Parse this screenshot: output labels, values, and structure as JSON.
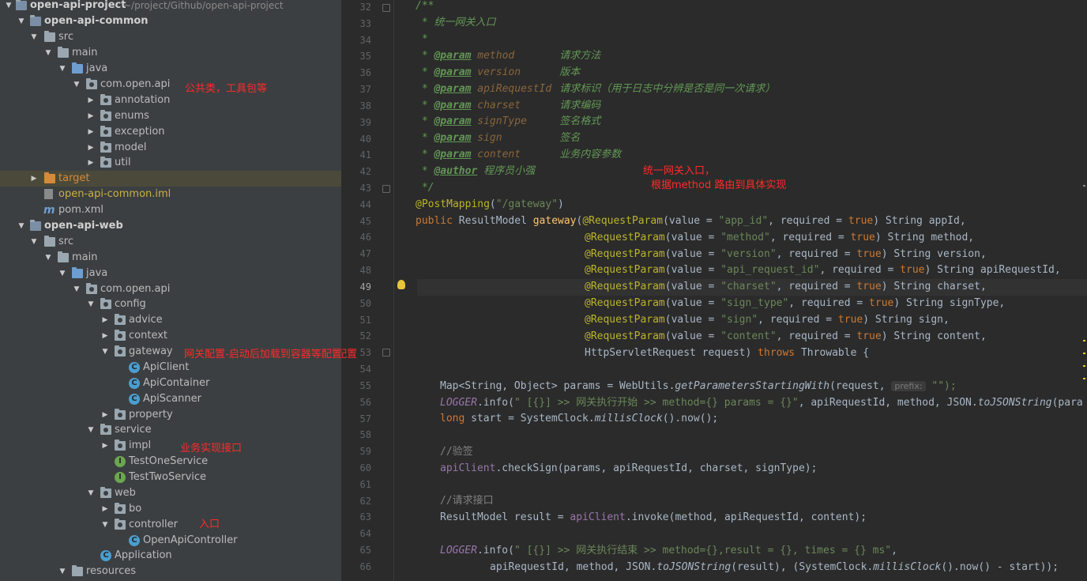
{
  "project_tree": {
    "root": {
      "name": "open-api-project",
      "path": "~/project/Github/open-api-project"
    },
    "items": [
      {
        "label": "open-api-common"
      },
      {
        "label": "src"
      },
      {
        "label": "main"
      },
      {
        "label": "java"
      },
      {
        "label": "com.open.api"
      },
      {
        "label": "annotation"
      },
      {
        "label": "enums"
      },
      {
        "label": "exception"
      },
      {
        "label": "model"
      },
      {
        "label": "util"
      },
      {
        "label": "target"
      },
      {
        "label": "open-api-common.iml"
      },
      {
        "label": "pom.xml"
      },
      {
        "label": "open-api-web"
      },
      {
        "label": "src"
      },
      {
        "label": "main"
      },
      {
        "label": "java"
      },
      {
        "label": "com.open.api"
      },
      {
        "label": "config"
      },
      {
        "label": "advice"
      },
      {
        "label": "context"
      },
      {
        "label": "gateway"
      },
      {
        "label": "ApiClient"
      },
      {
        "label": "ApiContainer"
      },
      {
        "label": "ApiScanner"
      },
      {
        "label": "property"
      },
      {
        "label": "service"
      },
      {
        "label": "impl"
      },
      {
        "label": "TestOneService"
      },
      {
        "label": "TestTwoService"
      },
      {
        "label": "web"
      },
      {
        "label": "bo"
      },
      {
        "label": "controller"
      },
      {
        "label": "OpenApiController"
      },
      {
        "label": "Application"
      },
      {
        "label": "resources"
      }
    ],
    "annotations": {
      "common_pkg": "公共类，工具包等",
      "gateway": "网关配置-启动后加载到容器等配置",
      "service": "业务实现接口",
      "controller": "入口"
    }
  },
  "editor": {
    "annotation_line1": "统一网关入口，",
    "annotation_line2": "根据method 路由到具体实现",
    "current_line": 49,
    "line_numbers": [
      "32",
      "33",
      "34",
      "35",
      "36",
      "37",
      "38",
      "39",
      "40",
      "41",
      "42",
      "43",
      "44",
      "45",
      "46",
      "47",
      "48",
      "49",
      "50",
      "51",
      "52",
      "53",
      "54",
      "55",
      "56",
      "57",
      "58",
      "59",
      "60",
      "61",
      "62",
      "63",
      "64",
      "65",
      "66"
    ],
    "doc": {
      "open": "/**",
      "summary": " * 统一网关入口",
      "star": " *",
      "params": [
        {
          "name": "method",
          "desc": "请求方法"
        },
        {
          "name": "version",
          "desc": "版本"
        },
        {
          "name": "apiRequestId",
          "desc": "请求标识（用于日志中分辨是否是同一次请求）"
        },
        {
          "name": "charset",
          "desc": "请求编码"
        },
        {
          "name": "signType",
          "desc": "签名格式"
        },
        {
          "name": "sign",
          "desc": "签名"
        },
        {
          "name": "content",
          "desc": "业务内容参数"
        }
      ],
      "author_tag": "@author",
      "author": "程序员小强",
      "close": " */"
    },
    "mapping": {
      "annotation": "@PostMapping",
      "path": "\"/gateway\""
    },
    "signature": {
      "modifier": "public",
      "return_type": "ResultModel",
      "method": "gateway"
    },
    "request_params": [
      {
        "value": "\"app_id\"",
        "required": "true",
        "type": "String",
        "name": "appId,"
      },
      {
        "value": "\"method\"",
        "required": "true",
        "type": "String",
        "name": "method,"
      },
      {
        "value": "\"version\"",
        "required": "true",
        "type": "String",
        "name": "version,"
      },
      {
        "value": "\"api_request_id\"",
        "required": "true",
        "type": "String",
        "name": "apiRequestId,"
      },
      {
        "value": "\"charset\"",
        "required": "true",
        "type": "String",
        "name": "charset,"
      },
      {
        "value": "\"sign_type\"",
        "required": "true",
        "type": "String",
        "name": "signType,"
      },
      {
        "value": "\"sign\"",
        "required": "true",
        "type": "String",
        "name": "sign,"
      },
      {
        "value": "\"content\"",
        "required": "true",
        "type": "String",
        "name": "content,"
      }
    ],
    "last_param": {
      "type": "HttpServletRequest",
      "name": "request)",
      "throws": "throws",
      "exception": "Throwable {"
    },
    "body": {
      "l55_a": "Map<String, Object> params = WebUtils.",
      "l55_fn": "getParametersStartingWith",
      "l55_b": "(request, ",
      "l55_hint": "prefix:",
      "l55_c": " \"\");",
      "l56_logger": "LOGGER",
      "l56_a": ".info(",
      "l56_str": "\" [{}] >> 网关执行开始 >> method={} params = {}\"",
      "l56_b": ", apiRequestId, method, JSON.",
      "l56_fn": "toJSONString",
      "l56_c": "(para",
      "l57_kw": "long",
      "l57_a": " start = SystemClock.",
      "l57_fn": "millisClock",
      "l57_b": "().now();",
      "l59": "//验签",
      "l60_fld": "apiClient",
      "l60_a": ".checkSign(params, apiRequestId, charset, signType);",
      "l62": "//请求接口",
      "l63_a": "ResultModel result = ",
      "l63_fld": "apiClient",
      "l63_b": ".invoke(method, apiRequestId, content);",
      "l65_logger": "LOGGER",
      "l65_a": ".info(",
      "l65_str": "\" [{}] >> 网关执行结束 >> method={},result = {}, times = {} ms\"",
      "l65_b": ",",
      "l66_a": "apiRequestId, method, JSON.",
      "l66_fn": "toJSONString",
      "l66_b": "(result), (SystemClock.",
      "l66_fn2": "millisClock",
      "l66_c": "().now() - start));"
    }
  }
}
